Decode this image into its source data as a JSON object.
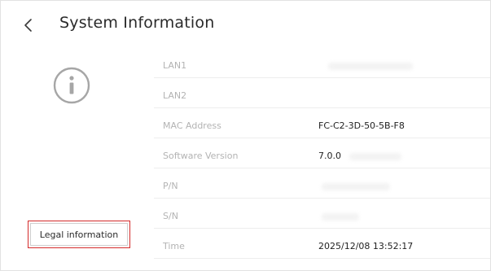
{
  "header": {
    "title": "System Information",
    "back_icon": "chevron-left-icon"
  },
  "info_icon": "info-circle-icon",
  "rows": [
    {
      "label": "LAN1",
      "value": ""
    },
    {
      "label": "LAN2",
      "value": ""
    },
    {
      "label": "MAC Address",
      "value": "FC-C2-3D-50-5B-F8"
    },
    {
      "label": "Software Version",
      "value": "7.0.0"
    },
    {
      "label": "P/N",
      "value": ""
    },
    {
      "label": "S/N",
      "value": ""
    },
    {
      "label": "Time",
      "value": "2025/12/08 13:52:17"
    }
  ],
  "legal_button": {
    "label": "Legal information",
    "border_color": "#d42a2a"
  }
}
